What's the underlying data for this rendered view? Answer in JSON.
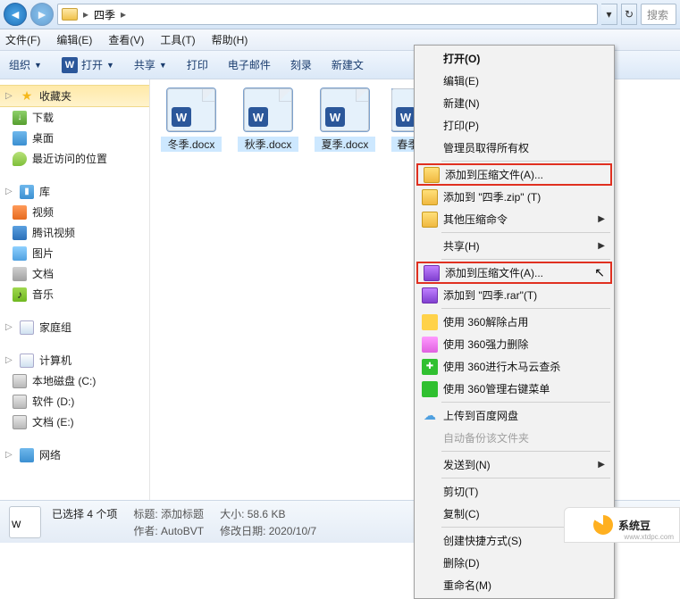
{
  "breadcrumb": {
    "folder": "四季"
  },
  "search": {
    "placeholder": "搜索"
  },
  "menubar": {
    "file": "文件(F)",
    "edit": "编辑(E)",
    "view": "查看(V)",
    "tools": "工具(T)",
    "help": "帮助(H)"
  },
  "toolbar": {
    "organize": "组织",
    "open": "打开",
    "share": "共享",
    "print": "打印",
    "email": "电子邮件",
    "burn": "刻录",
    "newfolder": "新建文"
  },
  "sidebar": {
    "favorites": "收藏夹",
    "downloads": "下载",
    "desktop": "桌面",
    "recent": "最近访问的位置",
    "libraries": "库",
    "videos": "视频",
    "tencent": "腾讯视频",
    "pictures": "图片",
    "documents": "文档",
    "music": "音乐",
    "homegroup": "家庭组",
    "computer": "计算机",
    "driveC": "本地磁盘 (C:)",
    "driveD": "软件 (D:)",
    "driveE": "文档 (E:)",
    "network": "网络"
  },
  "files": [
    {
      "name": "冬季.docx"
    },
    {
      "name": "秋季.docx"
    },
    {
      "name": "夏季.docx"
    },
    {
      "name": "春季."
    }
  ],
  "context": {
    "open": "打开(O)",
    "edit": "编辑(E)",
    "new": "新建(N)",
    "print": "打印(P)",
    "admin": "管理员取得所有权",
    "addArchiveA": "添加到压缩文件(A)...",
    "addZip": "添加到 \"四季.zip\" (T)",
    "otherZip": "其他压缩命令",
    "shareH": "共享(H)",
    "addArchiveA2": "添加到压缩文件(A)...",
    "addRar": "添加到 \"四季.rar\"(T)",
    "use360a": "使用 360解除占用",
    "use360b": "使用 360强力删除",
    "use360c": "使用 360进行木马云查杀",
    "use360d": "使用 360管理右键菜单",
    "uploadCloud": "上传到百度网盘",
    "autoBackup": "自动备份该文件夹",
    "sendTo": "发送到(N)",
    "cut": "剪切(T)",
    "copy": "复制(C)",
    "shortcut": "创建快捷方式(S)",
    "delete": "删除(D)",
    "rename": "重命名(M)"
  },
  "details": {
    "selection": "已选择 4 个项",
    "titleLabel": "标题:",
    "titleVal": "添加标题",
    "authorLabel": "作者:",
    "authorVal": "AutoBVT",
    "sizeLabel": "大小:",
    "sizeVal": "58.6 KB",
    "dateLabel": "修改日期:",
    "dateVal": "2020/10/7"
  },
  "watermark": {
    "text": "系统豆",
    "url": "www.xtdpc.com"
  }
}
